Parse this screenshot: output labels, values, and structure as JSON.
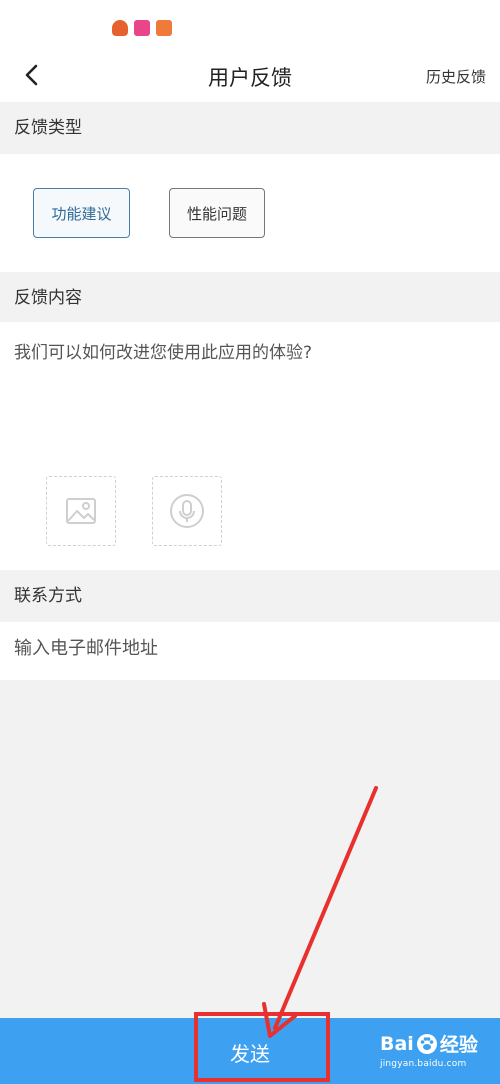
{
  "header": {
    "title": "用户反馈",
    "history_label": "历史反馈"
  },
  "type_section": {
    "label": "反馈类型",
    "options": [
      {
        "label": "功能建议",
        "selected": true
      },
      {
        "label": "性能问题",
        "selected": false
      }
    ]
  },
  "content_section": {
    "label": "反馈内容",
    "placeholder": "我们可以如何改进您使用此应用的体验?"
  },
  "contact_section": {
    "label": "联系方式",
    "placeholder": "输入电子邮件地址"
  },
  "footer": {
    "send_label": "发送"
  },
  "watermark": {
    "brand_a": "Bai",
    "brand_b": "经验",
    "url": "jingyan.baidu.com"
  },
  "colors": {
    "accent": "#3da0f1",
    "annotation": "#e8302e",
    "selected_border": "#4a7eaa"
  },
  "icons": [
    "chevron-left-icon",
    "image-icon",
    "microphone-icon",
    "paw-icon"
  ]
}
